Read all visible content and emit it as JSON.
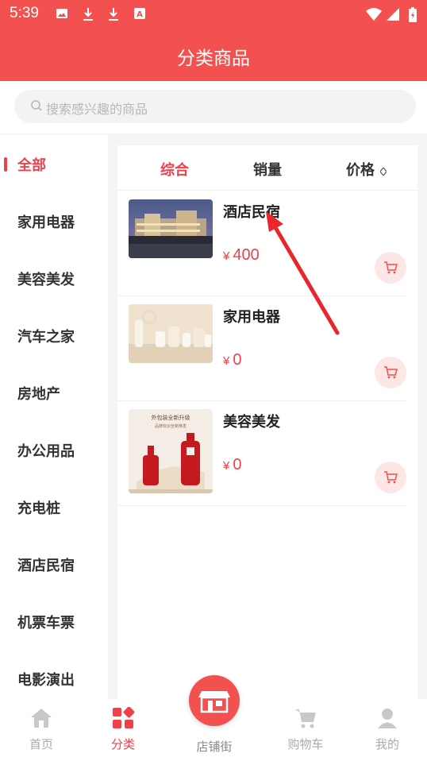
{
  "status": {
    "time": "5:39"
  },
  "header": {
    "title": "分类商品"
  },
  "search": {
    "placeholder": "搜索感兴趣的商品"
  },
  "sidebar": {
    "items": [
      "全部",
      "家用电器",
      "美容美发",
      "汽车之家",
      "房地产",
      "办公用品",
      "充电桩",
      "酒店民宿",
      "机票车票",
      "电影演出"
    ],
    "active_index": 0
  },
  "tabs": {
    "items": [
      "综合",
      "销量",
      "价格"
    ],
    "active_index": 0
  },
  "products": [
    {
      "name": "酒店民宿",
      "price": "400",
      "currency": "¥"
    },
    {
      "name": "家用电器",
      "price": "0",
      "currency": "¥"
    },
    {
      "name": "美容美发",
      "price": "0",
      "currency": "¥"
    }
  ],
  "product_image_text": {
    "line1": "外包装全新升级",
    "line2": "品牌标识全新焕发"
  },
  "bottom_nav": {
    "items": [
      {
        "label": "首页",
        "icon": "home-icon"
      },
      {
        "label": "分类",
        "icon": "category-icon"
      },
      {
        "label": "店铺街",
        "icon": "store-icon"
      },
      {
        "label": "购物车",
        "icon": "cart-icon"
      },
      {
        "label": "我的",
        "icon": "profile-icon"
      }
    ],
    "active_index": 1
  },
  "colors": {
    "accent": "#f2514f",
    "active_text": "#f0404a",
    "cart_bg": "#fde6e6"
  }
}
